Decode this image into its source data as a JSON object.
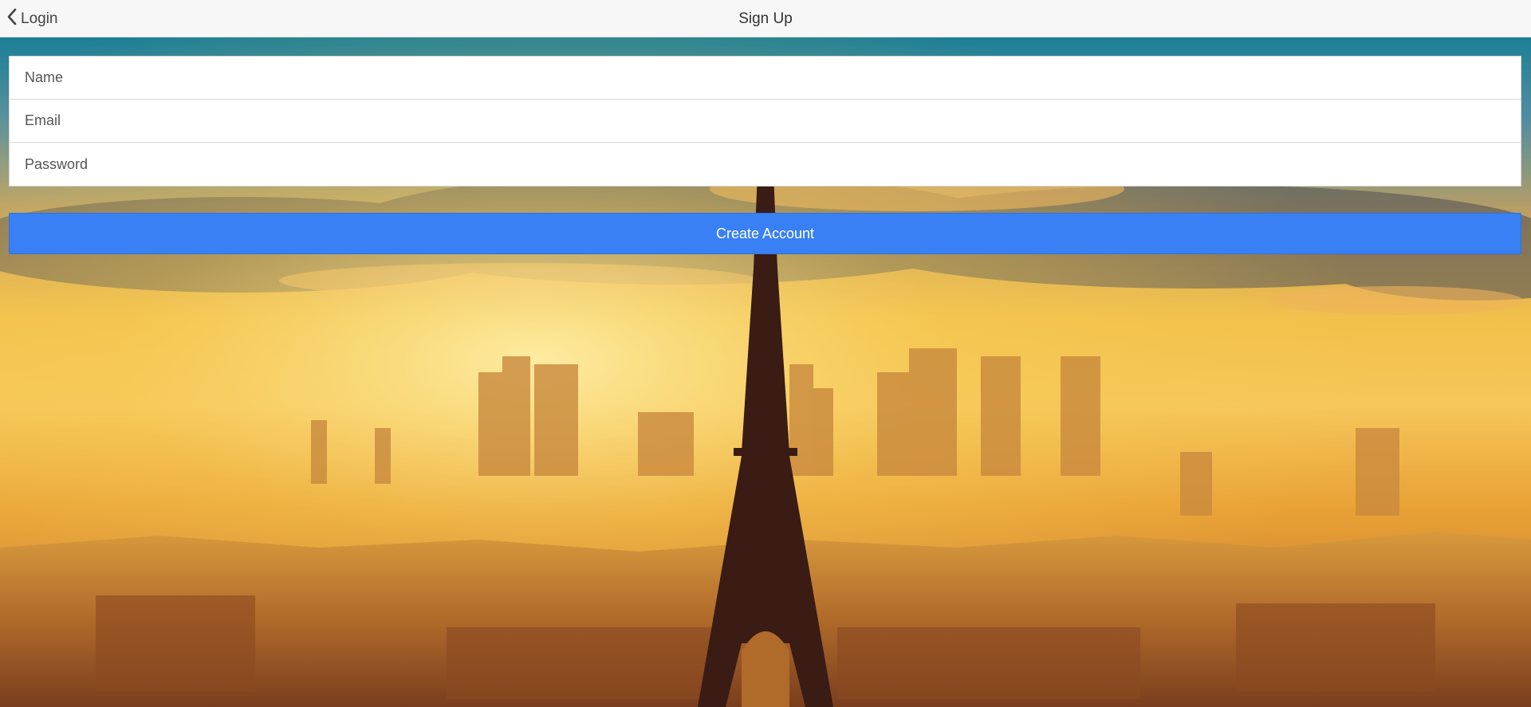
{
  "navbar": {
    "back_label": "Login",
    "title": "Sign Up",
    "back_icon": "chevron-left-icon"
  },
  "form": {
    "name_placeholder": "Name",
    "email_placeholder": "Email",
    "password_placeholder": "Password",
    "name_value": "",
    "email_value": "",
    "password_value": ""
  },
  "actions": {
    "create_label": "Create Account"
  },
  "colors": {
    "primary": "#3880f4",
    "navbar_bg": "#f7f7f7",
    "sky_top": "#1f7a8c",
    "sky_glow": "#f3c24a"
  },
  "background": {
    "icon": "eiffel-tower-skyline-image"
  }
}
